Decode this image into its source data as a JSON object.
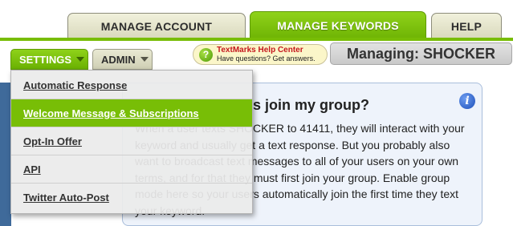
{
  "main_tabs": [
    {
      "label": "MANAGE ACCOUNT",
      "active": false
    },
    {
      "label": "MANAGE KEYWORDS",
      "active": true
    },
    {
      "label": "HELP",
      "active": false
    }
  ],
  "subnav": {
    "settings_label": "SETTINGS",
    "admin_label": "ADMIN"
  },
  "help_center": {
    "icon": "question-icon",
    "title": "TextMarks Help Center",
    "subtitle": "Have questions? Get answers."
  },
  "managing_label": "Managing: SHOCKER",
  "settings_menu": {
    "items": [
      {
        "label": "Automatic Response"
      },
      {
        "label": "Welcome Message & Subscriptions",
        "selected": true
      },
      {
        "label": "Opt-In Offer"
      },
      {
        "label": "API"
      },
      {
        "label": "Twitter Auto-Post"
      }
    ]
  },
  "card": {
    "title": "...why would users join my group?",
    "visible_title": "join my group?",
    "body": "When a user texts SHOCKER to 41411, they will interact with your keyword and usually get a text response. But you probably also want to broadcast text messages to all of your users on your own terms, and for that they must first join your group. Enable group mode here so your users automatically join the first time they text your keyword.",
    "info_icon": "info-icon"
  },
  "colors": {
    "brand_green": "#78bd06",
    "tab_inactive": "#e4e4c8",
    "card_bg": "#eef3fb",
    "help_title_red": "#c5161d"
  }
}
